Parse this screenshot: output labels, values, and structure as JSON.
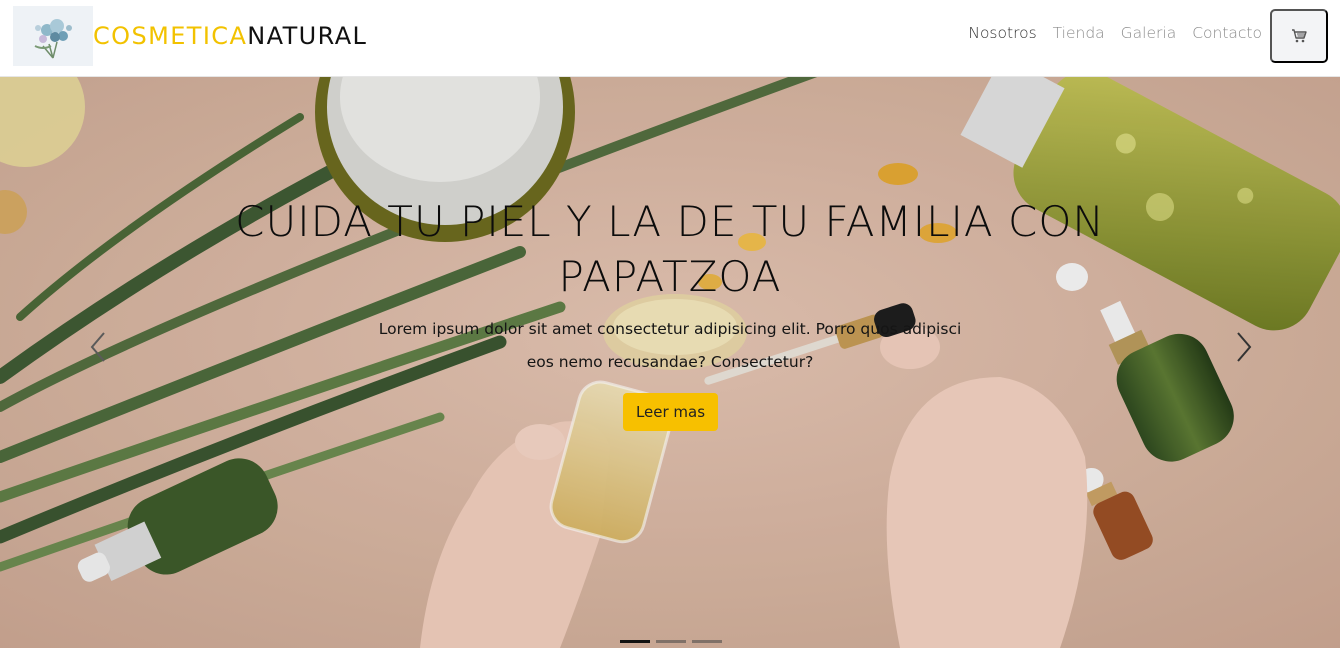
{
  "navbar": {
    "brand": {
      "part1": "COSMETICA",
      "part2": "NATURAL",
      "logo_icon": "flower-bouquet-logo"
    },
    "links": [
      {
        "label": "Nosotros",
        "active": true
      },
      {
        "label": "Tienda",
        "active": false
      },
      {
        "label": "Galeria",
        "active": false
      },
      {
        "label": "Contacto",
        "active": false
      }
    ],
    "cart_icon": "shopping-cart-icon"
  },
  "hero": {
    "title": "CUIDA TU PIEL Y LA DE TU FAMILIA CON PAPATZOA",
    "text": "Lorem ipsum dolor sit amet consectetur adipisicing elit. Porro quos adipisci eos nemo recusandae? Consectetur?",
    "button_label": "Leer mas",
    "prev_icon": "chevron-left-icon",
    "next_icon": "chevron-right-icon",
    "slides_count": 3,
    "active_slide": 1
  },
  "colors": {
    "brand_accent": "#f2c200",
    "button": "#f7c000",
    "hero_background": "#d9b8a5"
  }
}
